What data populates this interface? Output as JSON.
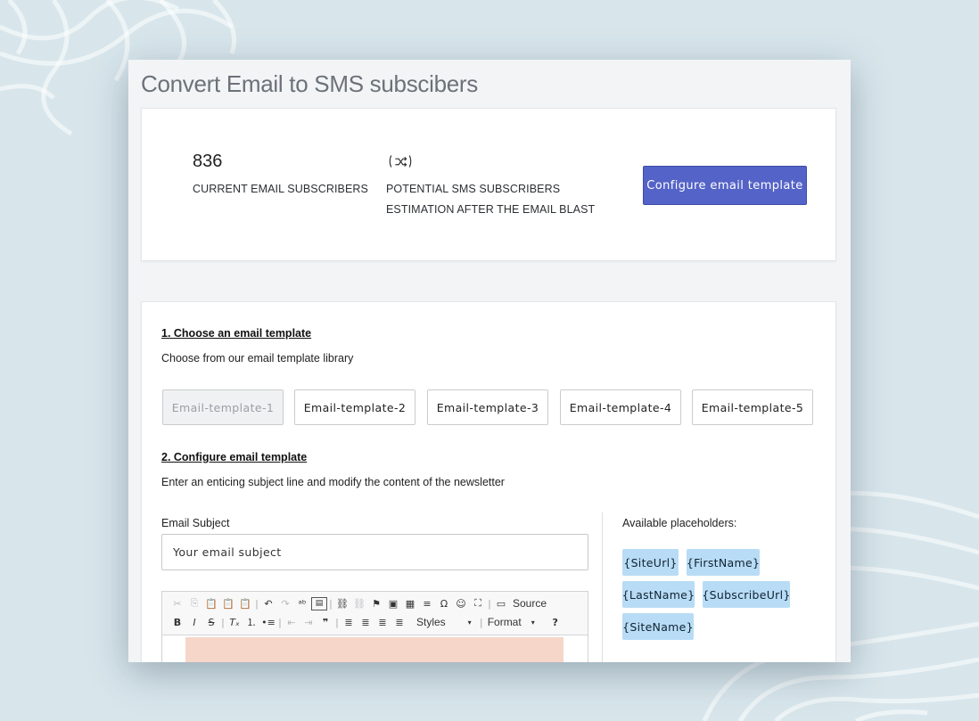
{
  "page": {
    "title": "Convert Email to SMS subscibers"
  },
  "stats": {
    "current_count": "836",
    "current_label": "CURRENT EMAIL SUBSCRIBERS",
    "potential_label": "POTENTIAL SMS SUBSCRIBERS",
    "potential_sublabel": "ESTIMATION AFTER THE EMAIL BLAST",
    "configure_button": "Configure email template"
  },
  "step1": {
    "title": "1. Choose an email template",
    "description": "Choose from our email template library",
    "templates": [
      "Email-template-1",
      "Email-template-2",
      "Email-template-3",
      "Email-template-4",
      "Email-template-5"
    ],
    "selected": "Email-template-1"
  },
  "step2": {
    "title": "2. Configure email template",
    "description": "Enter an enticing subject line and modify the content of the newsletter",
    "subject_label": "Email Subject",
    "subject_placeholder": "Your email subject",
    "toolbar": {
      "source_label": "Source",
      "styles_label": "Styles",
      "format_label": "Format",
      "help_label": "?"
    }
  },
  "placeholders": {
    "title": "Available placeholders:",
    "items": [
      "{SiteUrl}",
      "{FirstName}",
      "{LastName}",
      "{SubscribeUrl}",
      "{SiteName}"
    ]
  },
  "colors": {
    "primary_button": "#5463c7",
    "chip_bg": "#b8dcf5",
    "editor_content_bg": "#f5d6c8",
    "page_bg": "#d8e6ec"
  }
}
